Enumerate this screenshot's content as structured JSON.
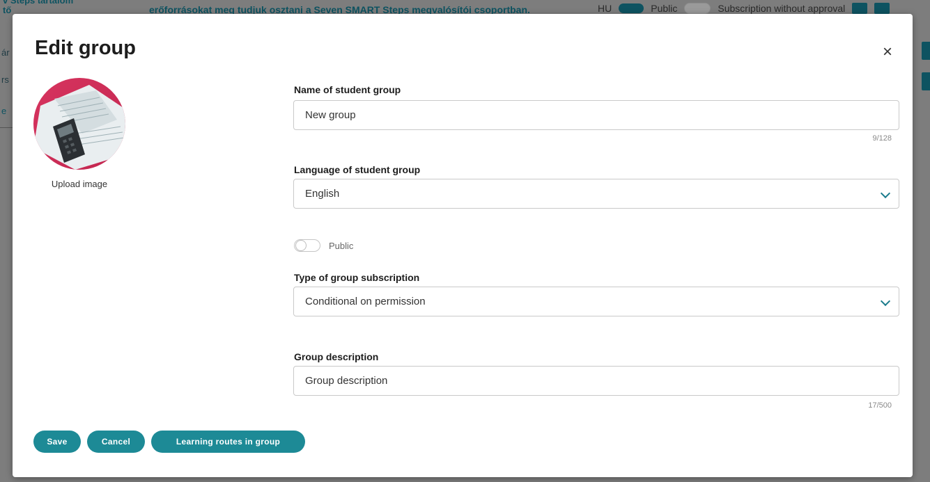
{
  "background": {
    "left_title": "v Steps tartalom",
    "left_title_sub": "tő",
    "banner_text": "erőforrásokat meg tudjuk osztani a Seven SMART Steps megvalósítói csoportban.",
    "lang_code": "HU",
    "public_label": "Public",
    "subscription_label": "Subscription without approval",
    "side_letters": [
      "ár",
      "rs",
      "e"
    ]
  },
  "modal": {
    "title": "Edit group",
    "close_symbol": "×",
    "upload_image_label": "Upload image",
    "name_field": {
      "label": "Name of student group",
      "value": "New group",
      "counter": "9/128"
    },
    "language_field": {
      "label": "Language of student group",
      "value": "English"
    },
    "public_toggle": {
      "label": "Public",
      "on": false
    },
    "subscription_field": {
      "label": "Type of group subscription",
      "value": "Conditional on permission"
    },
    "description_field": {
      "label": "Group description",
      "value": "Group description",
      "counter": "17/500"
    },
    "buttons": {
      "save": "Save",
      "cancel": "Cancel",
      "learning_routes": "Learning routes in group"
    }
  },
  "colors": {
    "accent": "#1d8a96",
    "dark_teal": "#0e5361",
    "chevron": "#1a7b8c"
  }
}
